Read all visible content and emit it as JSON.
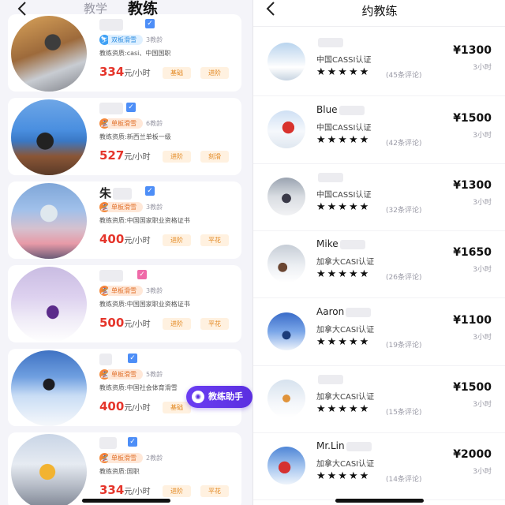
{
  "left": {
    "tabs": [
      {
        "label": "教学",
        "active": false
      },
      {
        "label": "教练",
        "active": true
      }
    ],
    "coaches": [
      {
        "name": "",
        "discipline": "双板滑雪",
        "discipline_color": "blue",
        "years": "3教龄",
        "qualification": "教练资质:casi、中国国职",
        "price": "334",
        "unit": "元/小时",
        "tags": [
          "基础",
          "进阶"
        ]
      },
      {
        "name": "",
        "discipline": "单板滑雪",
        "discipline_color": "orange",
        "years": "6教龄",
        "qualification": "教练资质:新西兰单板一级",
        "price": "527",
        "unit": "元/小时",
        "tags": [
          "进阶",
          "刻滑"
        ]
      },
      {
        "name": "朱",
        "discipline": "单板滑雪",
        "discipline_color": "orange",
        "years": "3教龄",
        "qualification": "教练资质:中国国家职业资格证书",
        "price": "400",
        "unit": "元/小时",
        "tags": [
          "进阶",
          "平花"
        ]
      },
      {
        "name": "",
        "discipline": "单板滑雪",
        "discipline_color": "orange",
        "years": "3教龄",
        "qualification": "教练资质:中国国家职业资格证书",
        "price": "500",
        "unit": "元/小时",
        "tags": [
          "进阶",
          "平花"
        ]
      },
      {
        "name": "",
        "discipline": "单板滑雪",
        "discipline_color": "orange",
        "years": "5教龄",
        "qualification": "教练资质:中国社会体育滑雪",
        "price": "400",
        "unit": "元/小时",
        "tags": [
          "基础"
        ]
      },
      {
        "name": "",
        "discipline": "单板滑雪",
        "discipline_color": "orange",
        "years": "2教龄",
        "qualification": "教练资质:国职",
        "price": "334",
        "unit": "元/小时",
        "tags": [
          "进阶",
          "平花"
        ]
      }
    ],
    "assistant_label": "教练助手",
    "assistant_icon": "chat-robot-icon"
  },
  "right": {
    "title": "约教练",
    "stars": "★★★★★",
    "coaches": [
      {
        "name": "",
        "cert": "中国CASSI认证",
        "reviews": "(45条评论)",
        "price": "¥1300",
        "duration": "3小时"
      },
      {
        "name": "Blue",
        "cert": "中国CASSI认证",
        "reviews": "(42条评论)",
        "price": "¥1500",
        "duration": "3小时"
      },
      {
        "name": "",
        "cert": "中国CASSI认证",
        "reviews": "(32条评论)",
        "price": "¥1300",
        "duration": "3小时"
      },
      {
        "name": "Mike",
        "cert": "加拿大CASI认证",
        "reviews": "(26条评论)",
        "price": "¥1650",
        "duration": "3小时"
      },
      {
        "name": "Aaron",
        "cert": "加拿大CASI认证",
        "reviews": "(19条评论)",
        "price": "¥1100",
        "duration": "3小时"
      },
      {
        "name": "",
        "cert": "加拿大CASI认证",
        "reviews": "(15条评论)",
        "price": "¥1500",
        "duration": "3小时"
      },
      {
        "name": "Mr.Lin",
        "cert": "加拿大CASI认证",
        "reviews": "(14条评论)",
        "price": "¥2000",
        "duration": "3小时"
      }
    ]
  },
  "colors": {
    "price_red": "#e5352b",
    "accent_purple": "#5b2fe0",
    "tag_orange": "#e38a25"
  }
}
